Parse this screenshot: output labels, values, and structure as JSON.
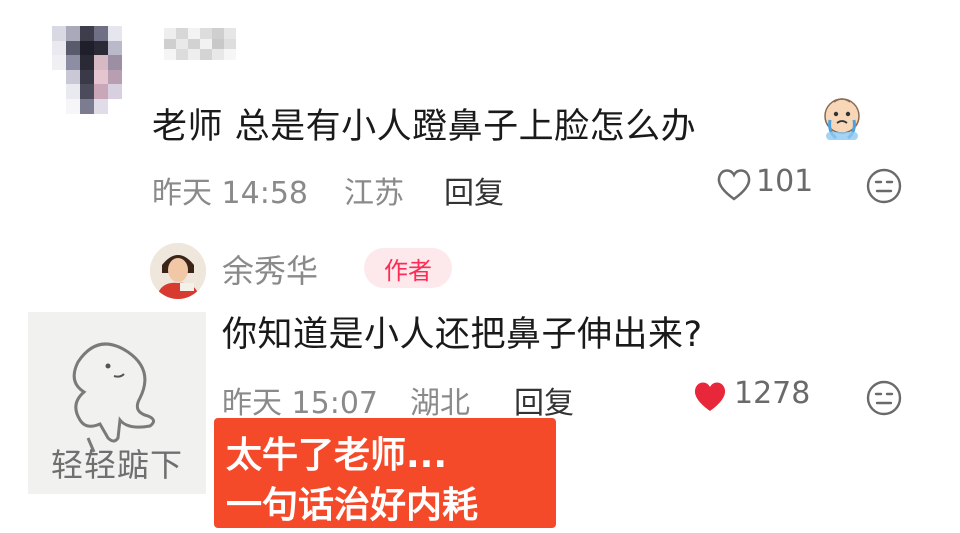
{
  "comment": {
    "text": "老师 总是有小人蹬鼻子上脸怎么办",
    "time": "昨天 14:58",
    "location": "江苏",
    "reply_label": "回复",
    "likes": "101",
    "emoji_icon": "crying-face-icon"
  },
  "author_reply": {
    "name": "余秀华",
    "badge": "作者",
    "text": "你知道是小人还把鼻子伸出来?",
    "time": "昨天 15:07",
    "location": "湖北",
    "reply_label": "回复",
    "likes": "1278",
    "liked": true
  },
  "sticker": {
    "caption": "轻轻踮下"
  },
  "overlay_caption": {
    "line1": "太牛了老师...",
    "line2": "一句话治好内耗"
  },
  "colors": {
    "accent": "#ff2a55",
    "caption_bg": "#f54a2a",
    "heart_liked": "#e8273a",
    "meta_gray": "#8a8a8a"
  }
}
